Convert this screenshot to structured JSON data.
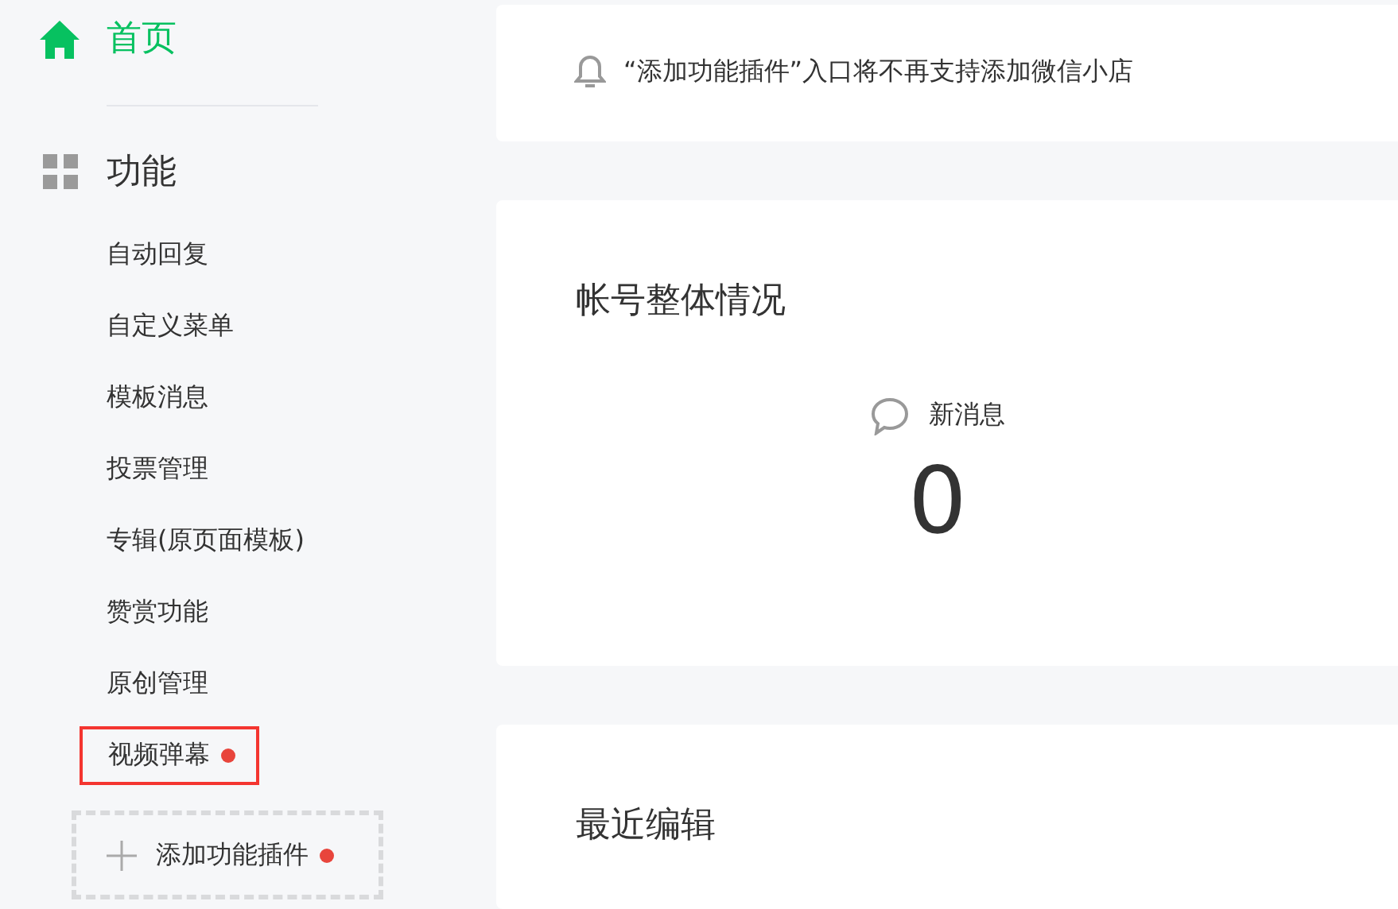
{
  "sidebar": {
    "home": {
      "label": "首页",
      "selected": true
    },
    "section": {
      "label": "功能"
    },
    "items": [
      {
        "label": "自动回复",
        "highlighted": false,
        "badge": false
      },
      {
        "label": "自定义菜单",
        "highlighted": false,
        "badge": false
      },
      {
        "label": "模板消息",
        "highlighted": false,
        "badge": false
      },
      {
        "label": "投票管理",
        "highlighted": false,
        "badge": false
      },
      {
        "label": "专辑(原页面模板)",
        "highlighted": false,
        "badge": false
      },
      {
        "label": "赞赏功能",
        "highlighted": false,
        "badge": false
      },
      {
        "label": "原创管理",
        "highlighted": false,
        "badge": false
      },
      {
        "label": "视频弹幕",
        "highlighted": true,
        "badge": true
      }
    ],
    "add_plugin": {
      "label": "添加功能插件",
      "badge": true
    }
  },
  "notice": {
    "text": "“添加功能插件”入口将不再支持添加微信小店"
  },
  "overview": {
    "title": "帐号整体情况",
    "stats": [
      {
        "label": "新消息",
        "value": "0"
      }
    ]
  },
  "recent": {
    "title": "最近编辑"
  }
}
